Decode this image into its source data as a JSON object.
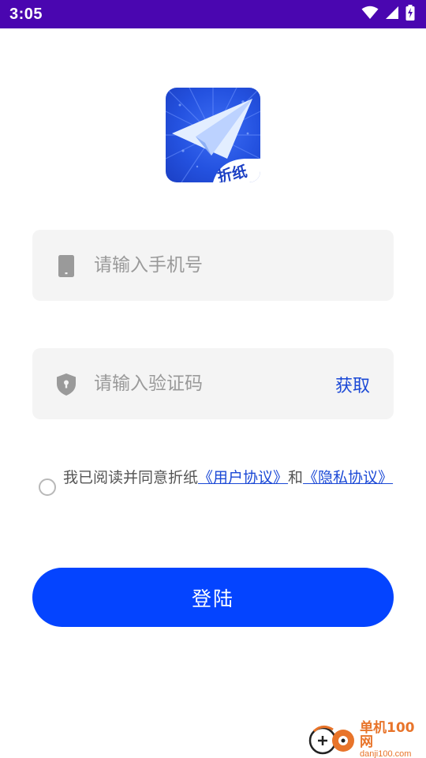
{
  "status_bar": {
    "time": "3:05",
    "icons": [
      "wifi-icon",
      "signal-icon",
      "battery-charging-icon"
    ]
  },
  "app": {
    "logo_text": "折纸",
    "logo_icon": "paper-plane-icon",
    "brand_color": "#2452e0"
  },
  "form": {
    "phone": {
      "placeholder": "请输入手机号",
      "value": "",
      "icon": "phone-icon"
    },
    "code": {
      "placeholder": "请输入验证码",
      "value": "",
      "icon": "shield-icon",
      "action_label": "获取"
    }
  },
  "agreement": {
    "prefix": "我已阅读并同意折纸",
    "user_agreement": "《用户协议》",
    "conjunction": "和",
    "privacy_policy": "《隐私协议》",
    "checked": false,
    "link_color": "#1b49d6"
  },
  "login_button": {
    "label": "登陆",
    "color": "#0444ff"
  },
  "watermark": {
    "site_name": "单机100网",
    "site_url": "danji100.com"
  }
}
